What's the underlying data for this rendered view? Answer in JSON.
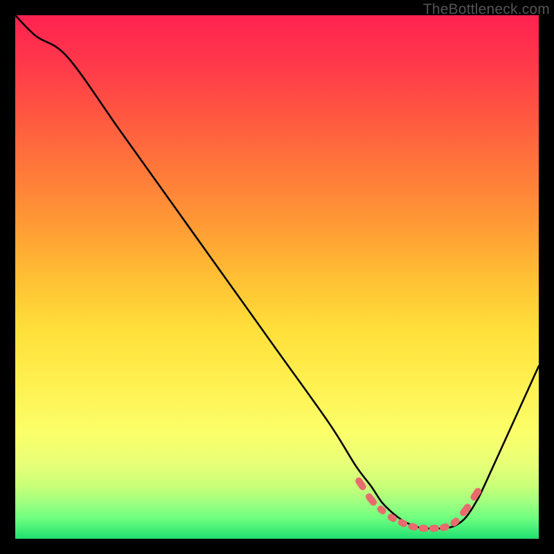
{
  "watermark": "TheBottleneck.com",
  "chart_data": {
    "type": "line",
    "title": "",
    "xlabel": "",
    "ylabel": "",
    "xlim": [
      0,
      100
    ],
    "ylim": [
      0,
      100
    ],
    "series": [
      {
        "name": "bottleneck-curve",
        "x": [
          0,
          4,
          10,
          20,
          30,
          40,
          50,
          60,
          65,
          68,
          70,
          72,
          74,
          76,
          78,
          80,
          82,
          84,
          86,
          88,
          90,
          100
        ],
        "y": [
          100,
          96,
          92,
          78,
          64,
          50,
          36,
          22,
          14,
          10,
          7,
          5,
          3.5,
          2.5,
          2,
          2,
          2,
          2.5,
          4,
          7,
          11,
          33
        ]
      }
    ],
    "markers": {
      "name": "highlighted-region",
      "color": "#e86b6d",
      "x": [
        66,
        68,
        70,
        72,
        74,
        76,
        78,
        80,
        82,
        84,
        86,
        88
      ],
      "y": [
        10.5,
        7.5,
        5.5,
        4,
        3,
        2.3,
        2,
        2,
        2.2,
        3.2,
        5.5,
        8.5
      ]
    }
  }
}
